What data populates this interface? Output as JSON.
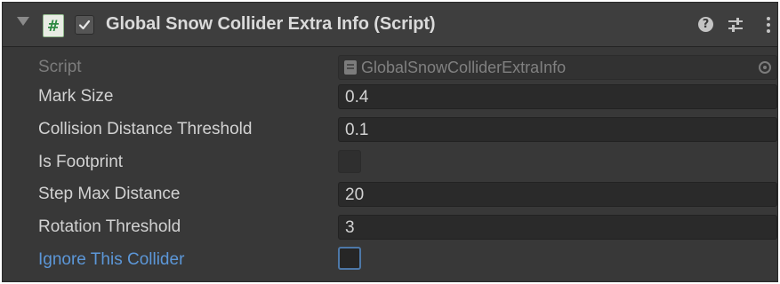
{
  "component": {
    "title": "Global Snow Collider Extra Info (Script)",
    "enabled": true,
    "icons": {
      "script": "csharp-script-icon",
      "help": "help-icon",
      "presets": "presets-icon",
      "menu": "kebab-menu-icon",
      "foldout": "foldout-arrow-icon"
    }
  },
  "script_field": {
    "label": "Script",
    "value": "GlobalSnowColliderExtraInfo"
  },
  "properties": [
    {
      "label": "Mark Size",
      "type": "float",
      "value": "0.4"
    },
    {
      "label": "Collision Distance Threshold",
      "type": "float",
      "value": "0.1"
    },
    {
      "label": "Is Footprint",
      "type": "bool",
      "checked": false,
      "disabled": true
    },
    {
      "label": "Step Max Distance",
      "type": "float",
      "value": "20"
    },
    {
      "label": "Rotation Threshold",
      "type": "float",
      "value": "3"
    },
    {
      "label": "Ignore This Collider",
      "type": "bool",
      "checked": false,
      "overridden": true
    }
  ],
  "colors": {
    "panel_bg": "#383838",
    "field_bg": "#2a2a2a",
    "label": "#d2d2d2",
    "disabled_label": "#7c7c7c",
    "override_label": "#5c97d8",
    "script_icon_green": "#2f8a44"
  }
}
